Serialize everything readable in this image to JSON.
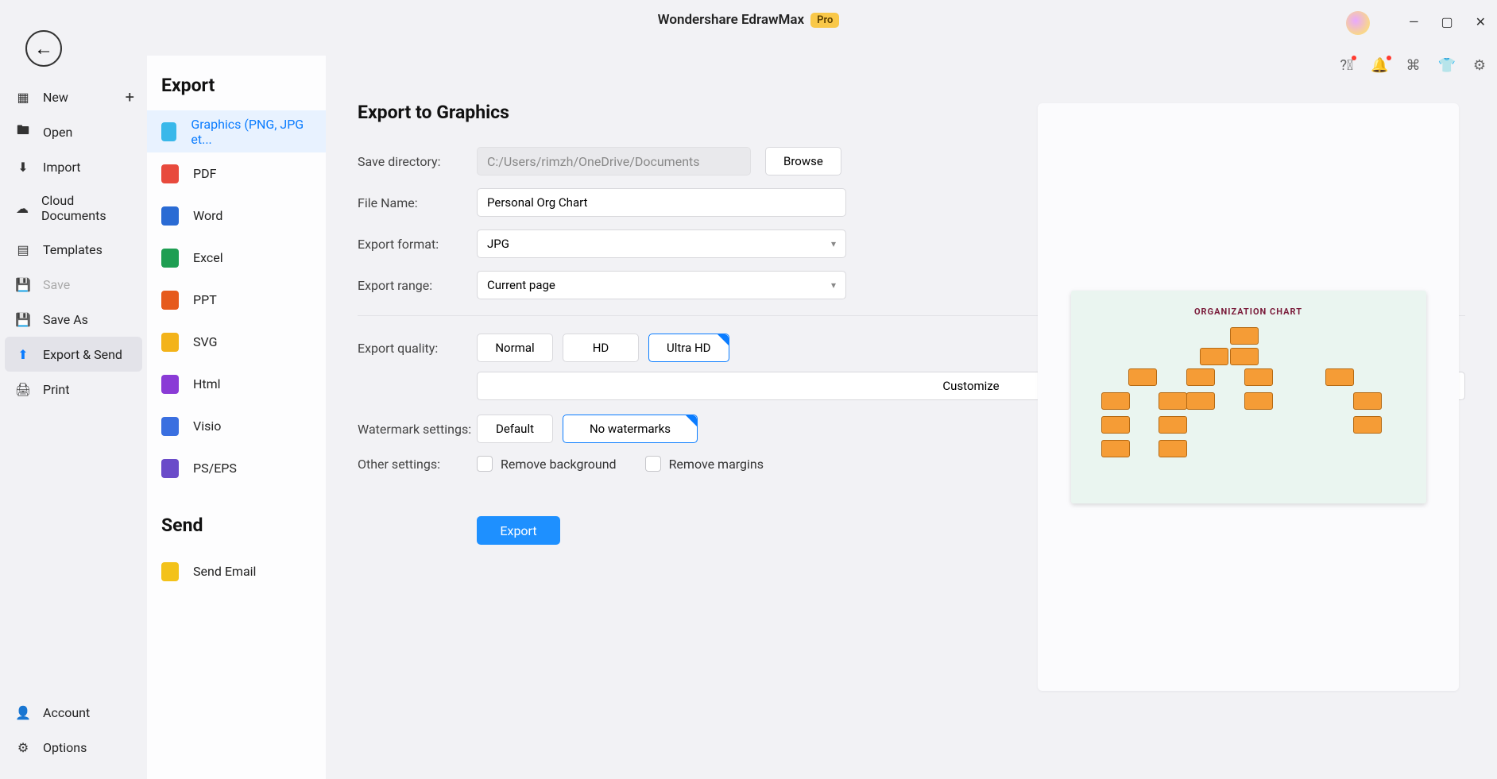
{
  "app": {
    "title": "Wondershare EdrawMax",
    "badge": "Pro"
  },
  "left_sidebar": {
    "items": [
      {
        "label": "New",
        "icon": "plus-square"
      },
      {
        "label": "Open",
        "icon": "folder"
      },
      {
        "label": "Import",
        "icon": "download"
      },
      {
        "label": "Cloud Documents",
        "icon": "cloud"
      },
      {
        "label": "Templates",
        "icon": "template"
      },
      {
        "label": "Save",
        "icon": "save",
        "disabled": true
      },
      {
        "label": "Save As",
        "icon": "save-as"
      },
      {
        "label": "Export & Send",
        "icon": "export",
        "active": true
      },
      {
        "label": "Print",
        "icon": "print"
      }
    ],
    "bottom": [
      {
        "label": "Account",
        "icon": "account"
      },
      {
        "label": "Options",
        "icon": "gear"
      }
    ]
  },
  "export_sidebar": {
    "heading": "Export",
    "items": [
      {
        "label": "Graphics (PNG, JPG et...",
        "color": "#39b8ea",
        "active": true
      },
      {
        "label": "PDF",
        "color": "#e84a3d"
      },
      {
        "label": "Word",
        "color": "#2a6bd4"
      },
      {
        "label": "Excel",
        "color": "#1e9e52"
      },
      {
        "label": "PPT",
        "color": "#e65a1c"
      },
      {
        "label": "SVG",
        "color": "#f3b31a"
      },
      {
        "label": "Html",
        "color": "#8a3bd6"
      },
      {
        "label": "Visio",
        "color": "#3a6fe0"
      },
      {
        "label": "PS/EPS",
        "color": "#6a4bc9"
      }
    ],
    "send_heading": "Send",
    "send_items": [
      {
        "label": "Send Email",
        "color": "#f3c21a"
      }
    ]
  },
  "main": {
    "title": "Export to Graphics",
    "labels": {
      "save_dir": "Save directory:",
      "file_name": "File Name:",
      "format": "Export format:",
      "range": "Export range:",
      "quality": "Export quality:",
      "watermark": "Watermark settings:",
      "other": "Other settings:"
    },
    "values": {
      "save_dir": "C:/Users/rimzh/OneDrive/Documents",
      "file_name": "Personal Org Chart",
      "format": "JPG",
      "range": "Current page"
    },
    "browse": "Browse",
    "quality": {
      "normal": "Normal",
      "hd": "HD",
      "ultra": "Ultra HD",
      "customize": "Customize"
    },
    "watermark": {
      "default": "Default",
      "none": "No watermarks"
    },
    "checkboxes": {
      "remove_bg": "Remove background",
      "remove_margins": "Remove margins"
    },
    "export_btn": "Export"
  },
  "preview": {
    "title": "ORGANIZATION CHART"
  }
}
